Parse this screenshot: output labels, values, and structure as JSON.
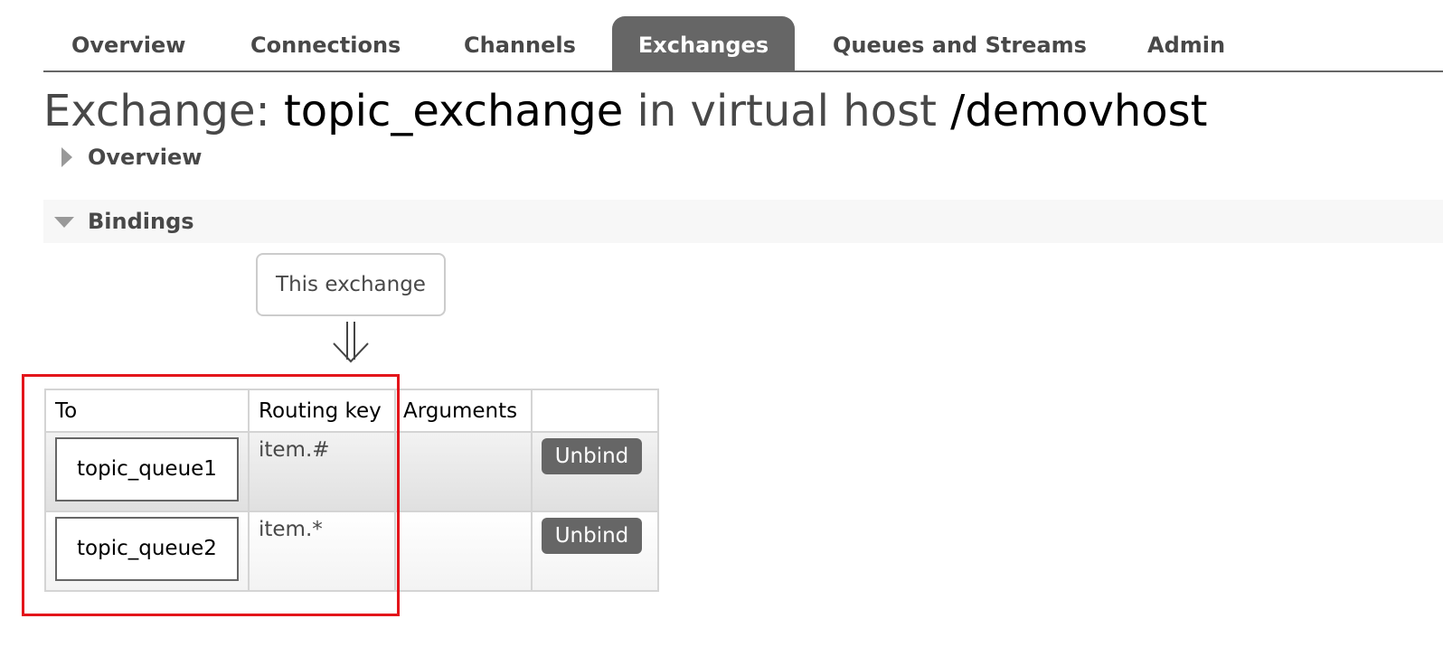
{
  "nav": {
    "tabs": [
      {
        "label": "Overview",
        "active": false
      },
      {
        "label": "Connections",
        "active": false
      },
      {
        "label": "Channels",
        "active": false
      },
      {
        "label": "Exchanges",
        "active": true
      },
      {
        "label": "Queues and Streams",
        "active": false
      },
      {
        "label": "Admin",
        "active": false
      }
    ]
  },
  "title": {
    "prefix": "Exchange:",
    "exchange_name": "topic_exchange",
    "middle": "in virtual host",
    "vhost": "/demovhost"
  },
  "sections": {
    "overview": {
      "label": "Overview",
      "expanded": false
    },
    "bindings": {
      "label": "Bindings",
      "expanded": true
    }
  },
  "bindings": {
    "source_label": "This exchange",
    "columns": [
      "To",
      "Routing key",
      "Arguments",
      ""
    ],
    "rows": [
      {
        "to": "topic_queue1",
        "routing_key": "item.#",
        "arguments": "",
        "action": "Unbind"
      },
      {
        "to": "topic_queue2",
        "routing_key": "item.*",
        "arguments": "",
        "action": "Unbind"
      }
    ]
  },
  "colors": {
    "nav_active_bg": "#666666",
    "section_bg": "#f7f7f7",
    "button_bg": "#666666",
    "highlight": "#e3151b"
  },
  "icons": {
    "flow_arrow": "double-down-arrow-icon",
    "overview_toggle": "triangle-right-icon",
    "bindings_toggle": "triangle-down-icon"
  }
}
